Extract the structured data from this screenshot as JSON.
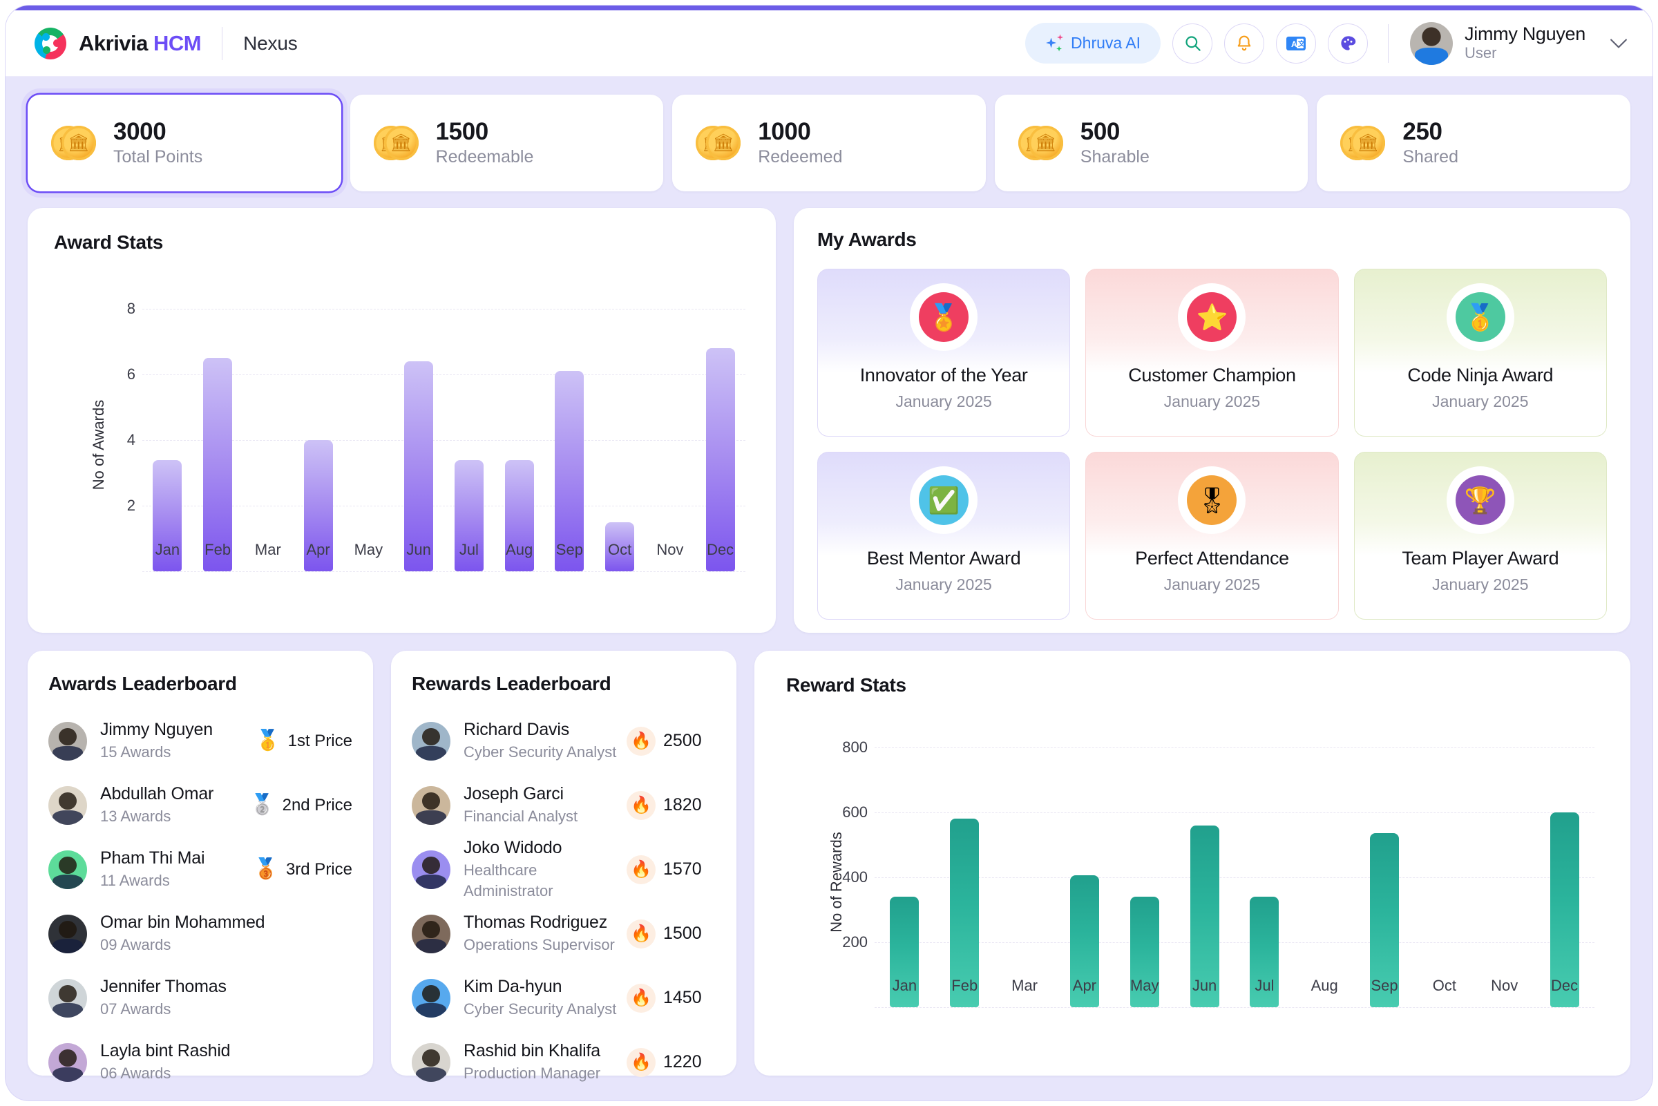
{
  "header": {
    "brand_first": "Akrivia",
    "brand_second": "HCM",
    "module": "Nexus",
    "ai_button": "Dhruva AI",
    "icons": [
      "search-icon",
      "bell-icon",
      "translate-icon",
      "palette-icon"
    ],
    "user_name": "Jimmy Nguyen",
    "user_role": "User"
  },
  "stats": [
    {
      "value": "3000",
      "label": "Total Points",
      "active": true
    },
    {
      "value": "1500",
      "label": "Redeemable",
      "active": false
    },
    {
      "value": "1000",
      "label": "Redeemed",
      "active": false
    },
    {
      "value": "500",
      "label": "Sharable",
      "active": false
    },
    {
      "value": "250",
      "label": "Shared",
      "active": false
    }
  ],
  "award_stats": {
    "title": "Award Stats"
  },
  "reward_stats": {
    "title": "Reward Stats"
  },
  "my_awards": {
    "title": "My Awards",
    "items": [
      {
        "name": "Innovator of the Year",
        "date": "January 2025",
        "theme": "blue",
        "glyph": "🏅",
        "core": "#ef3e60"
      },
      {
        "name": "Customer Champion",
        "date": "January 2025",
        "theme": "pink",
        "glyph": "⭐",
        "core": "#ef3e60"
      },
      {
        "name": "Code Ninja Award",
        "date": "January 2025",
        "theme": "green",
        "glyph": "🥇",
        "core": "#4ec9a0"
      },
      {
        "name": "Best Mentor Award",
        "date": "January 2025",
        "theme": "blue",
        "glyph": "✅",
        "core": "#4fc3e8"
      },
      {
        "name": "Perfect Attendance",
        "date": "January 2025",
        "theme": "pink",
        "glyph": "🎖",
        "core": "#f4a33a"
      },
      {
        "name": "Team Player Award",
        "date": "January 2025",
        "theme": "green",
        "glyph": "🏆",
        "core": "#8e55b8"
      }
    ]
  },
  "awards_leaderboard": {
    "title": "Awards Leaderboard",
    "rows": [
      {
        "name": "Jimmy Nguyen",
        "sub": "15 Awards",
        "prize": "1st Price",
        "medal": "🥇",
        "av": "#b7b3ae"
      },
      {
        "name": "Abdullah Omar",
        "sub": "13 Awards",
        "prize": "2nd Price",
        "medal": "🥈",
        "av": "#ded6c8"
      },
      {
        "name": "Pham Thi Mai",
        "sub": "11 Awards",
        "prize": "3rd Price",
        "medal": "🥉",
        "av": "#5ddc9a"
      },
      {
        "name": "Omar bin Mohammed",
        "sub": "09 Awards",
        "prize": "",
        "medal": "",
        "av": "#2f3238"
      },
      {
        "name": "Jennifer Thomas",
        "sub": "07 Awards",
        "prize": "",
        "medal": "",
        "av": "#cfd5d8"
      },
      {
        "name": "Layla bint Rashid",
        "sub": "06 Awards",
        "prize": "",
        "medal": "",
        "av": "#c3a8d6"
      }
    ]
  },
  "rewards_leaderboard": {
    "title": "Rewards Leaderboard",
    "rows": [
      {
        "name": "Richard Davis",
        "sub": "Cyber Security Analyst",
        "points": "2500",
        "av": "#9fb6c9"
      },
      {
        "name": "Joseph Garci",
        "sub": "Financial Analyst",
        "points": "1820",
        "av": "#cbb79c"
      },
      {
        "name": "Joko Widodo",
        "sub": "Healthcare Administrator",
        "points": "1570",
        "av": "#9b8ef0"
      },
      {
        "name": "Thomas Rodriguez",
        "sub": "Operations Supervisor",
        "points": "1500",
        "av": "#7e6a5c"
      },
      {
        "name": "Kim Da-hyun",
        "sub": "Cyber Security Analyst",
        "points": "1450",
        "av": "#57a9ee"
      },
      {
        "name": "Rashid bin Khalifa",
        "sub": "Production Manager",
        "points": "1220",
        "av": "#d8d5cf"
      }
    ]
  },
  "chart_data": [
    {
      "type": "bar",
      "title": "Award Stats",
      "xlabel": "",
      "ylabel": "No of Awards",
      "categories": [
        "Jan",
        "Feb",
        "Mar",
        "Apr",
        "May",
        "Jun",
        "Jul",
        "Aug",
        "Sep",
        "Oct",
        "Nov",
        "Dec"
      ],
      "values": [
        3.4,
        6.5,
        0,
        4.0,
        0,
        6.4,
        3.4,
        3.4,
        6.1,
        1.5,
        0,
        6.8
      ],
      "ylim": [
        0,
        8.8
      ],
      "yticks": [
        2,
        4,
        6,
        8
      ],
      "grid": true,
      "legend": "none",
      "color": "#7c55ee"
    },
    {
      "type": "bar",
      "title": "Reward Stats",
      "xlabel": "",
      "ylabel": "No of Rewards",
      "categories": [
        "Jan",
        "Feb",
        "Mar",
        "Apr",
        "May",
        "Jun",
        "Jul",
        "Aug",
        "Sep",
        "Oct",
        "Nov",
        "Dec"
      ],
      "values": [
        340,
        580,
        0,
        405,
        340,
        560,
        340,
        0,
        535,
        0,
        0,
        600
      ],
      "ylim": [
        0,
        880
      ],
      "yticks": [
        200,
        400,
        600,
        800
      ],
      "grid": true,
      "legend": "none",
      "color": "#2bb49c"
    }
  ]
}
